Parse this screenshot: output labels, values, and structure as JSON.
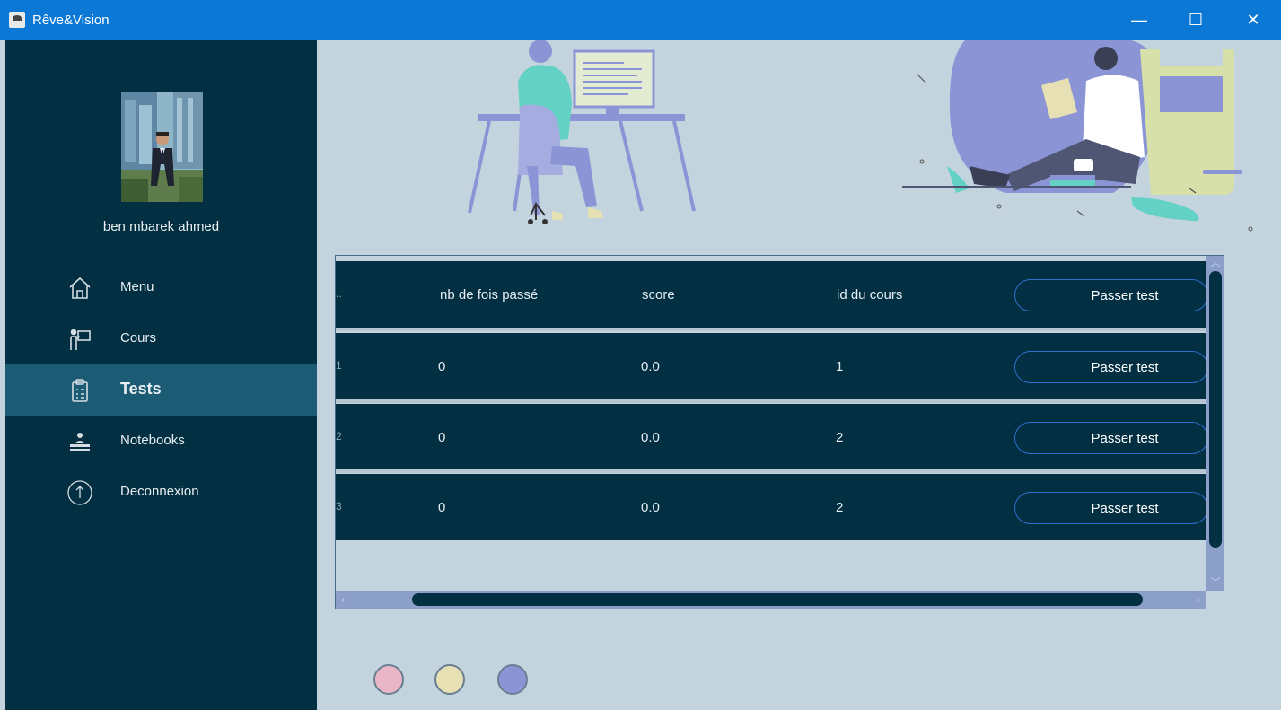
{
  "window": {
    "title": "Rêve&Vision",
    "minimize_glyph": "—",
    "maximize_glyph": "☐",
    "close_glyph": "✕"
  },
  "sidebar": {
    "username": "ben mbarek ahmed",
    "items": [
      {
        "label": "Menu",
        "icon": "home-icon",
        "active": false
      },
      {
        "label": "Cours",
        "icon": "teacher-board-icon",
        "active": false
      },
      {
        "label": "Tests",
        "icon": "clipboard-icon",
        "active": true
      },
      {
        "label": "Notebooks",
        "icon": "desk-student-icon",
        "active": false
      },
      {
        "label": "Deconnexion",
        "icon": "power-icon",
        "active": false
      }
    ]
  },
  "table": {
    "header": {
      "cut_text": "..",
      "col_passes": "nb de fois passé",
      "col_score": "score",
      "col_course": "id du cours",
      "action": "Passer test"
    },
    "rows": [
      {
        "cut_text": "1",
        "passes": "0",
        "score": "0.0",
        "course_id": "1",
        "action": "Passer test"
      },
      {
        "cut_text": "2",
        "passes": "0",
        "score": "0.0",
        "course_id": "2",
        "action": "Passer test"
      },
      {
        "cut_text": "3",
        "passes": "0",
        "score": "0.0",
        "course_id": "2",
        "action": "Passer test"
      }
    ]
  },
  "colors": {
    "titlebar": "#0b78d6",
    "sidebar": "#023042",
    "sidebar_active": "#1b5b73",
    "content_bg": "#c4d4df",
    "row_bg": "#023042",
    "button_border": "#2e6fd0",
    "illustration_accent": "#8b95d6",
    "dot_pink": "#e8b6c6",
    "dot_yellow": "#e6e0b4",
    "dot_blue": "#8b95d6"
  }
}
